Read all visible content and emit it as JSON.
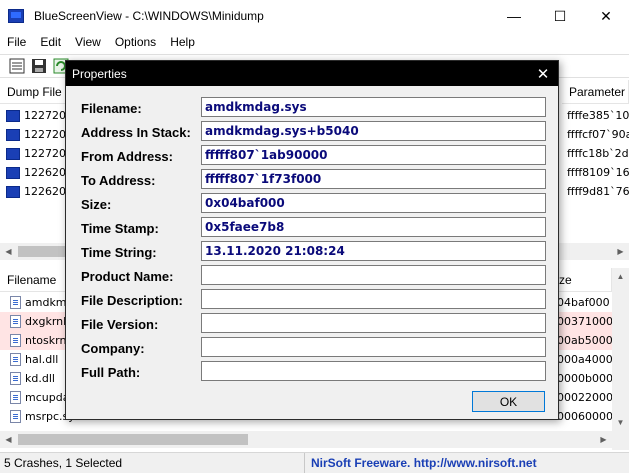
{
  "window": {
    "title": "BlueScreenView  -  C:\\WINDOWS\\Minidump",
    "minimize_glyph": "—",
    "maximize_glyph": "☐",
    "close_glyph": "✕"
  },
  "menu": [
    "File",
    "Edit",
    "View",
    "Options",
    "Help"
  ],
  "toolbar_icons": [
    "properties-icon",
    "save-icon",
    "refresh-icon"
  ],
  "upper_list": {
    "columns": {
      "dump_file": "Dump File",
      "parameter": "Parameter"
    },
    "rows": [
      {
        "dump_file": "122720-8",
        "parameter": "ffffe385`10"
      },
      {
        "dump_file": "122720-9",
        "parameter": "ffffcf07`90a"
      },
      {
        "dump_file": "122720-8",
        "parameter": "ffffc18b`2d"
      },
      {
        "dump_file": "122620-8",
        "parameter": "ffff8109`16"
      },
      {
        "dump_file": "122620-7",
        "parameter": "ffff9d81`76"
      }
    ]
  },
  "lower_list": {
    "columns": {
      "filename": "Filename",
      "size": "ze"
    },
    "rows": [
      {
        "filename": "amdkmd",
        "size": "04baf000",
        "highlight": false
      },
      {
        "filename": "dxgkrnl.",
        "size": "00371000",
        "highlight": true
      },
      {
        "filename": "ntoskrnl",
        "size": "00ab5000",
        "highlight": true
      },
      {
        "filename": "hal.dll",
        "size": "000a4000",
        "highlight": false
      },
      {
        "filename": "kd.dll",
        "size": "0000b000",
        "highlight": false
      },
      {
        "filename": "mcupda",
        "size": "00022000",
        "highlight": false
      },
      {
        "filename": "msrpc.sy",
        "size": "00060000",
        "highlight": false
      }
    ]
  },
  "status": {
    "left": "5 Crashes, 1 Selected",
    "right": "NirSoft Freeware.  http://www.nirsoft.net"
  },
  "dialog": {
    "title": "Properties",
    "close_glyph": "✕",
    "ok_label": "OK",
    "fields": [
      {
        "label": "Filename:",
        "value": "amdkmdag.sys"
      },
      {
        "label": "Address In Stack:",
        "value": "amdkmdag.sys+b5040"
      },
      {
        "label": "From Address:",
        "value": "fffff807`1ab90000"
      },
      {
        "label": "To Address:",
        "value": "fffff807`1f73f000"
      },
      {
        "label": "Size:",
        "value": "0x04baf000"
      },
      {
        "label": "Time Stamp:",
        "value": "0x5faee7b8"
      },
      {
        "label": "Time String:",
        "value": "13.11.2020 21:08:24"
      },
      {
        "label": "Product Name:",
        "value": ""
      },
      {
        "label": "File Description:",
        "value": ""
      },
      {
        "label": "File Version:",
        "value": ""
      },
      {
        "label": "Company:",
        "value": ""
      },
      {
        "label": "Full Path:",
        "value": ""
      }
    ]
  },
  "colors": {
    "accent": "#0078d7",
    "field_text": "#0a0a7a",
    "link": "#1a3fb5",
    "highlight_row": "#ffe4e4"
  }
}
